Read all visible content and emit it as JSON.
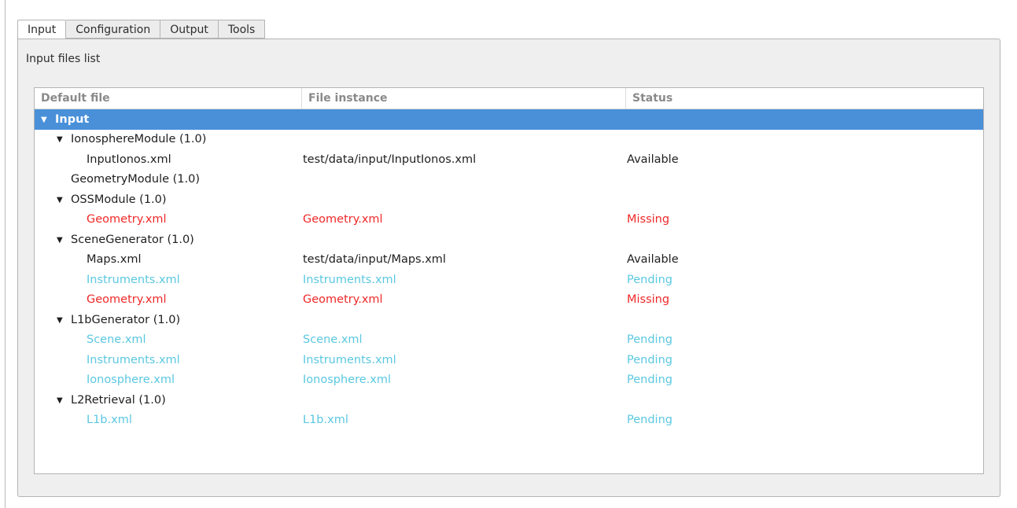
{
  "tabs": [
    "Input",
    "Configuration",
    "Output",
    "Tools"
  ],
  "panel_title": "Input files list",
  "columns": [
    "Default file",
    "File instance",
    "Status"
  ],
  "root": {
    "label": "Input",
    "arrow": "▼"
  },
  "rows": [
    {
      "level": 1,
      "arrow": "▼",
      "name": "IonosphereModule (1.0)",
      "instance": "",
      "status": "",
      "state": "group"
    },
    {
      "level": 2,
      "name": "InputIonos.xml",
      "instance": "test/data/input/InputIonos.xml",
      "status": "Available",
      "state": "available"
    },
    {
      "level": 1,
      "arrow": "",
      "name": "GeometryModule (1.0)",
      "instance": "",
      "status": "",
      "state": "group"
    },
    {
      "level": 1,
      "arrow": "▼",
      "name": "OSSModule (1.0)",
      "instance": "",
      "status": "",
      "state": "group"
    },
    {
      "level": 2,
      "name": "Geometry.xml",
      "instance": "Geometry.xml",
      "status": "Missing",
      "state": "missing"
    },
    {
      "level": 1,
      "arrow": "▼",
      "name": "SceneGenerator (1.0)",
      "instance": "",
      "status": "",
      "state": "group"
    },
    {
      "level": 2,
      "name": "Maps.xml",
      "instance": "test/data/input/Maps.xml",
      "status": "Available",
      "state": "available"
    },
    {
      "level": 2,
      "name": "Instruments.xml",
      "instance": "Instruments.xml",
      "status": "Pending",
      "state": "pending"
    },
    {
      "level": 2,
      "name": "Geometry.xml",
      "instance": "Geometry.xml",
      "status": "Missing",
      "state": "missing"
    },
    {
      "level": 1,
      "arrow": "▼",
      "name": "L1bGenerator (1.0)",
      "instance": "",
      "status": "",
      "state": "group"
    },
    {
      "level": 2,
      "name": "Scene.xml",
      "instance": "Scene.xml",
      "status": "Pending",
      "state": "pending"
    },
    {
      "level": 2,
      "name": "Instruments.xml",
      "instance": "Instruments.xml",
      "status": "Pending",
      "state": "pending"
    },
    {
      "level": 2,
      "name": "Ionosphere.xml",
      "instance": "Ionosphere.xml",
      "status": "Pending",
      "state": "pending"
    },
    {
      "level": 1,
      "arrow": "▼",
      "name": "L2Retrieval (1.0)",
      "instance": "",
      "status": "",
      "state": "group"
    },
    {
      "level": 2,
      "name": "L1b.xml",
      "instance": "L1b.xml",
      "status": "Pending",
      "state": "pending"
    }
  ],
  "colors": {
    "selection": "#4a90d9",
    "missing": "#ef2929",
    "pending": "#5bc8e0",
    "available": "#1e1e1e"
  }
}
